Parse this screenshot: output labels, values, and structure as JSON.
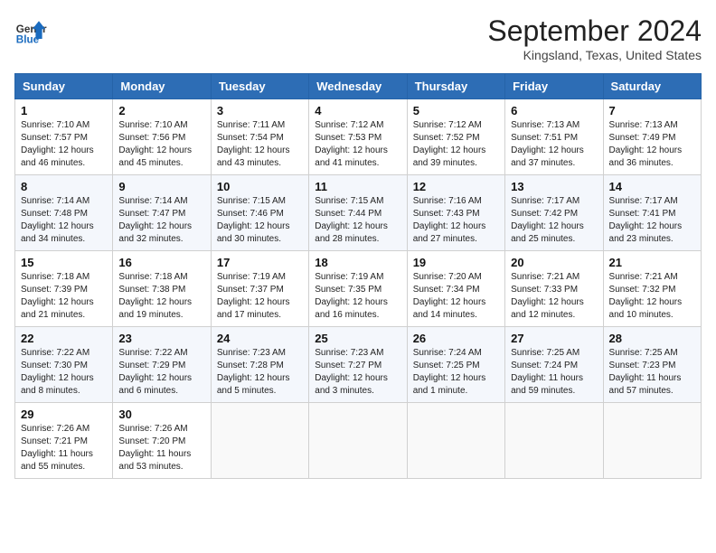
{
  "header": {
    "logo_line1": "General",
    "logo_line2": "Blue",
    "month": "September 2024",
    "location": "Kingsland, Texas, United States"
  },
  "weekdays": [
    "Sunday",
    "Monday",
    "Tuesday",
    "Wednesday",
    "Thursday",
    "Friday",
    "Saturday"
  ],
  "weeks": [
    [
      {
        "day": "1",
        "info": "Sunrise: 7:10 AM\nSunset: 7:57 PM\nDaylight: 12 hours\nand 46 minutes."
      },
      {
        "day": "2",
        "info": "Sunrise: 7:10 AM\nSunset: 7:56 PM\nDaylight: 12 hours\nand 45 minutes."
      },
      {
        "day": "3",
        "info": "Sunrise: 7:11 AM\nSunset: 7:54 PM\nDaylight: 12 hours\nand 43 minutes."
      },
      {
        "day": "4",
        "info": "Sunrise: 7:12 AM\nSunset: 7:53 PM\nDaylight: 12 hours\nand 41 minutes."
      },
      {
        "day": "5",
        "info": "Sunrise: 7:12 AM\nSunset: 7:52 PM\nDaylight: 12 hours\nand 39 minutes."
      },
      {
        "day": "6",
        "info": "Sunrise: 7:13 AM\nSunset: 7:51 PM\nDaylight: 12 hours\nand 37 minutes."
      },
      {
        "day": "7",
        "info": "Sunrise: 7:13 AM\nSunset: 7:49 PM\nDaylight: 12 hours\nand 36 minutes."
      }
    ],
    [
      {
        "day": "8",
        "info": "Sunrise: 7:14 AM\nSunset: 7:48 PM\nDaylight: 12 hours\nand 34 minutes."
      },
      {
        "day": "9",
        "info": "Sunrise: 7:14 AM\nSunset: 7:47 PM\nDaylight: 12 hours\nand 32 minutes."
      },
      {
        "day": "10",
        "info": "Sunrise: 7:15 AM\nSunset: 7:46 PM\nDaylight: 12 hours\nand 30 minutes."
      },
      {
        "day": "11",
        "info": "Sunrise: 7:15 AM\nSunset: 7:44 PM\nDaylight: 12 hours\nand 28 minutes."
      },
      {
        "day": "12",
        "info": "Sunrise: 7:16 AM\nSunset: 7:43 PM\nDaylight: 12 hours\nand 27 minutes."
      },
      {
        "day": "13",
        "info": "Sunrise: 7:17 AM\nSunset: 7:42 PM\nDaylight: 12 hours\nand 25 minutes."
      },
      {
        "day": "14",
        "info": "Sunrise: 7:17 AM\nSunset: 7:41 PM\nDaylight: 12 hours\nand 23 minutes."
      }
    ],
    [
      {
        "day": "15",
        "info": "Sunrise: 7:18 AM\nSunset: 7:39 PM\nDaylight: 12 hours\nand 21 minutes."
      },
      {
        "day": "16",
        "info": "Sunrise: 7:18 AM\nSunset: 7:38 PM\nDaylight: 12 hours\nand 19 minutes."
      },
      {
        "day": "17",
        "info": "Sunrise: 7:19 AM\nSunset: 7:37 PM\nDaylight: 12 hours\nand 17 minutes."
      },
      {
        "day": "18",
        "info": "Sunrise: 7:19 AM\nSunset: 7:35 PM\nDaylight: 12 hours\nand 16 minutes."
      },
      {
        "day": "19",
        "info": "Sunrise: 7:20 AM\nSunset: 7:34 PM\nDaylight: 12 hours\nand 14 minutes."
      },
      {
        "day": "20",
        "info": "Sunrise: 7:21 AM\nSunset: 7:33 PM\nDaylight: 12 hours\nand 12 minutes."
      },
      {
        "day": "21",
        "info": "Sunrise: 7:21 AM\nSunset: 7:32 PM\nDaylight: 12 hours\nand 10 minutes."
      }
    ],
    [
      {
        "day": "22",
        "info": "Sunrise: 7:22 AM\nSunset: 7:30 PM\nDaylight: 12 hours\nand 8 minutes."
      },
      {
        "day": "23",
        "info": "Sunrise: 7:22 AM\nSunset: 7:29 PM\nDaylight: 12 hours\nand 6 minutes."
      },
      {
        "day": "24",
        "info": "Sunrise: 7:23 AM\nSunset: 7:28 PM\nDaylight: 12 hours\nand 5 minutes."
      },
      {
        "day": "25",
        "info": "Sunrise: 7:23 AM\nSunset: 7:27 PM\nDaylight: 12 hours\nand 3 minutes."
      },
      {
        "day": "26",
        "info": "Sunrise: 7:24 AM\nSunset: 7:25 PM\nDaylight: 12 hours\nand 1 minute."
      },
      {
        "day": "27",
        "info": "Sunrise: 7:25 AM\nSunset: 7:24 PM\nDaylight: 11 hours\nand 59 minutes."
      },
      {
        "day": "28",
        "info": "Sunrise: 7:25 AM\nSunset: 7:23 PM\nDaylight: 11 hours\nand 57 minutes."
      }
    ],
    [
      {
        "day": "29",
        "info": "Sunrise: 7:26 AM\nSunset: 7:21 PM\nDaylight: 11 hours\nand 55 minutes."
      },
      {
        "day": "30",
        "info": "Sunrise: 7:26 AM\nSunset: 7:20 PM\nDaylight: 11 hours\nand 53 minutes."
      },
      {
        "day": "",
        "info": ""
      },
      {
        "day": "",
        "info": ""
      },
      {
        "day": "",
        "info": ""
      },
      {
        "day": "",
        "info": ""
      },
      {
        "day": "",
        "info": ""
      }
    ]
  ]
}
